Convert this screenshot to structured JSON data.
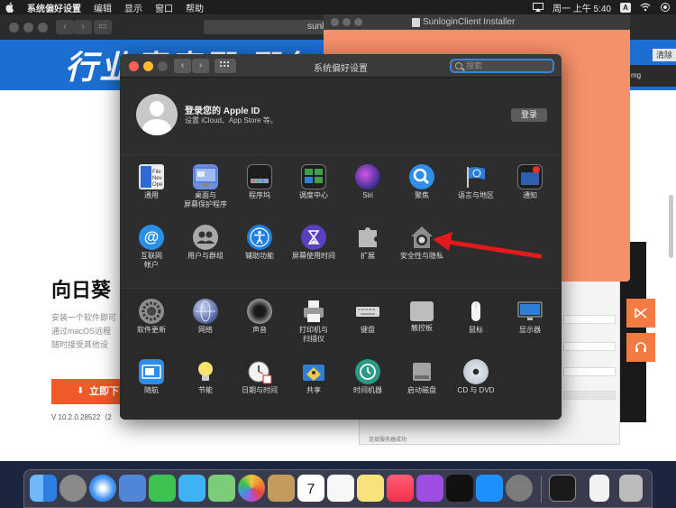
{
  "menubar": {
    "app_name": "系统偏好设置",
    "items": [
      "编辑",
      "显示",
      "窗口",
      "帮助"
    ],
    "clock": "周一 上午 5:40",
    "input_badge": "A"
  },
  "browser": {
    "url_fragment": "sunl",
    "banner_text": "行业青春殿 殿年",
    "page_title": "向日葵",
    "desc_lines": [
      "安装一个软件即可",
      "通过macOS远程",
      "随时接受其他设"
    ],
    "download_label": "立即下",
    "version": "V 10.2.0.28522（2",
    "clear_label": "清除",
    "strip_text": "mg",
    "status_text": "连接服务器成功"
  },
  "installer": {
    "title": "SunloginClient Installer"
  },
  "prefs": {
    "window_title": "系统偏好设置",
    "search_placeholder": "搜索",
    "account": {
      "title": "登录您的 Apple ID",
      "subtitle": "设置 iCloud、App Store 等。",
      "login_button": "登录"
    },
    "row1": [
      {
        "name": "general",
        "label": "通用",
        "icon": "general-icon"
      },
      {
        "name": "desktop-screensaver",
        "label": "桌面与",
        "label2": "屏幕保护程序",
        "icon": "desktop-icon"
      },
      {
        "name": "dock",
        "label": "程序坞",
        "icon": "dock-icon"
      },
      {
        "name": "mission-control",
        "label": "调度中心",
        "icon": "mission-control-icon"
      },
      {
        "name": "siri",
        "label": "Siri",
        "icon": "siri-icon"
      },
      {
        "name": "spotlight",
        "label": "聚焦",
        "icon": "spotlight-icon"
      },
      {
        "name": "language-region",
        "label": "语言与地区",
        "icon": "flag-icon"
      },
      {
        "name": "notifications",
        "label": "通知",
        "icon": "notifications-icon"
      }
    ],
    "row2": [
      {
        "name": "internet-accounts",
        "label": "互联网",
        "label2": "帐户",
        "icon": "at-icon"
      },
      {
        "name": "users-groups",
        "label": "用户与群组",
        "icon": "users-icon"
      },
      {
        "name": "accessibility",
        "label": "辅助功能",
        "icon": "accessibility-icon"
      },
      {
        "name": "screen-time",
        "label": "屏幕使用时间",
        "icon": "hourglass-icon"
      },
      {
        "name": "extensions",
        "label": "扩展",
        "icon": "puzzle-icon"
      },
      {
        "name": "security-privacy",
        "label": "安全性与隐私",
        "icon": "house-lock-icon"
      }
    ],
    "row3": [
      {
        "name": "software-update",
        "label": "软件更新",
        "icon": "gear-update-icon"
      },
      {
        "name": "network",
        "label": "网络",
        "icon": "globe-icon"
      },
      {
        "name": "sound",
        "label": "声音",
        "icon": "speaker-icon"
      },
      {
        "name": "printers-scanners",
        "label": "打印机与",
        "label2": "扫描仪",
        "icon": "printer-icon"
      },
      {
        "name": "keyboard",
        "label": "键盘",
        "icon": "keyboard-icon"
      },
      {
        "name": "trackpad",
        "label": "触控板",
        "icon": "trackpad-icon"
      },
      {
        "name": "mouse",
        "label": "鼠标",
        "icon": "mouse-icon"
      },
      {
        "name": "displays",
        "label": "显示器",
        "icon": "display-icon"
      }
    ],
    "row4": [
      {
        "name": "sidecar",
        "label": "随航",
        "icon": "sidecar-icon"
      },
      {
        "name": "energy-saver",
        "label": "节能",
        "icon": "bulb-icon"
      },
      {
        "name": "date-time",
        "label": "日期与时间",
        "icon": "clock-icon"
      },
      {
        "name": "sharing",
        "label": "共享",
        "icon": "sharing-icon"
      },
      {
        "name": "time-machine",
        "label": "时间机器",
        "icon": "time-machine-icon"
      },
      {
        "name": "startup-disk",
        "label": "启动磁盘",
        "icon": "disk-icon"
      },
      {
        "name": "cds-dvds",
        "label": "CD 与 DVD",
        "icon": "dvd-icon"
      }
    ]
  },
  "dock": {
    "apps": [
      "finder-icon",
      "launchpad-icon",
      "safari-icon",
      "mail-icon",
      "facetime-icon",
      "messages-icon",
      "maps-icon",
      "photos-icon",
      "contacts-icon",
      "calendar-icon",
      "reminders-icon",
      "notes-icon",
      "music-icon",
      "podcasts-icon",
      "appletv-icon",
      "appstore-icon",
      "system-preferences-icon",
      "terminal-icon",
      "document-icon",
      "trash-icon"
    ],
    "calendar_day": "7"
  },
  "colors": {
    "accent_blue": "#3b82d8",
    "arrow_red": "#e11b1b",
    "installer_orange": "#f5906b",
    "download_orange": "#ee5a28"
  }
}
